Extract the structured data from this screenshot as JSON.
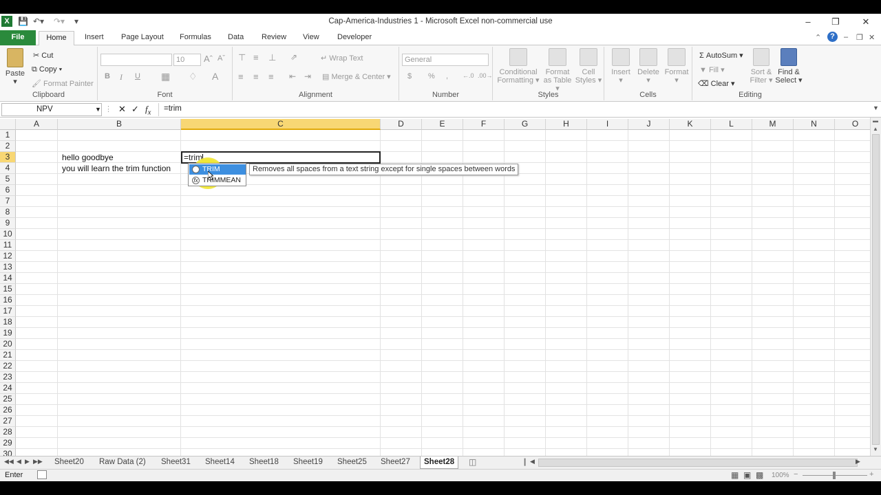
{
  "window": {
    "title": "Cap-America-Industries 1  -  Microsoft Excel non-commercial use"
  },
  "tabs": {
    "file": "File",
    "items": [
      "Home",
      "Insert",
      "Page Layout",
      "Formulas",
      "Data",
      "Review",
      "View",
      "Developer"
    ]
  },
  "ribbon": {
    "clipboard": {
      "paste": "Paste",
      "cut": "Cut",
      "copy": "Copy",
      "format_painter": "Format Painter",
      "label": "Clipboard"
    },
    "font": {
      "size": "10",
      "bold": "B",
      "italic": "I",
      "underline": "U",
      "label": "Font"
    },
    "alignment": {
      "wrap_text": "Wrap Text",
      "merge_center": "Merge & Center",
      "label": "Alignment"
    },
    "number": {
      "format": "General",
      "currency": "$",
      "percent": "%",
      "comma": ",",
      "label": "Number"
    },
    "styles": {
      "conditional": "Conditional",
      "conditional2": "Formatting",
      "format_as": "Format",
      "format_as2": "as Table",
      "cell": "Cell",
      "cell2": "Styles",
      "label": "Styles"
    },
    "cells": {
      "insert": "Insert",
      "delete": "Delete",
      "format": "Format",
      "label": "Cells"
    },
    "editing": {
      "autosum": "AutoSum",
      "fill": "Fill",
      "clear": "Clear",
      "sort": "Sort &",
      "sort2": "Filter",
      "find": "Find &",
      "find2": "Select",
      "label": "Editing"
    }
  },
  "formula_bar": {
    "name_box": "NPV",
    "formula": "=trim"
  },
  "grid": {
    "columns": [
      "A",
      "B",
      "C",
      "D",
      "E",
      "F",
      "G",
      "H",
      "I",
      "J",
      "K",
      "L",
      "M",
      "N",
      "O"
    ],
    "rows": [
      "1",
      "2",
      "3",
      "4",
      "5",
      "6",
      "7",
      "8",
      "9",
      "10",
      "11",
      "12",
      "13",
      "14",
      "15",
      "16",
      "17",
      "18",
      "19",
      "20",
      "21",
      "22",
      "23",
      "24",
      "25",
      "26",
      "27",
      "28",
      "29",
      "30"
    ],
    "b3": "hello  goodbye",
    "b4": "you will  learn the trim function",
    "active_cell_value": "=trim"
  },
  "autocomplete": {
    "items": [
      "TRIM",
      "TRIMMEAN"
    ],
    "tooltip": "Removes all spaces from a text string except for single spaces between words"
  },
  "sheets": {
    "tabs": [
      "Sheet20",
      "Raw Data (2)",
      "Sheet31",
      "Sheet14",
      "Sheet18",
      "Sheet19",
      "Sheet25",
      "Sheet27"
    ],
    "active": "Sheet28"
  },
  "status": {
    "mode": "Enter",
    "zoom": "100%"
  },
  "colors": {
    "file_tab": "#2a8a3c",
    "selected_header": "#f8d774",
    "autocomplete_selected": "#3d8fe0",
    "highlight": "#f4ee1e"
  }
}
